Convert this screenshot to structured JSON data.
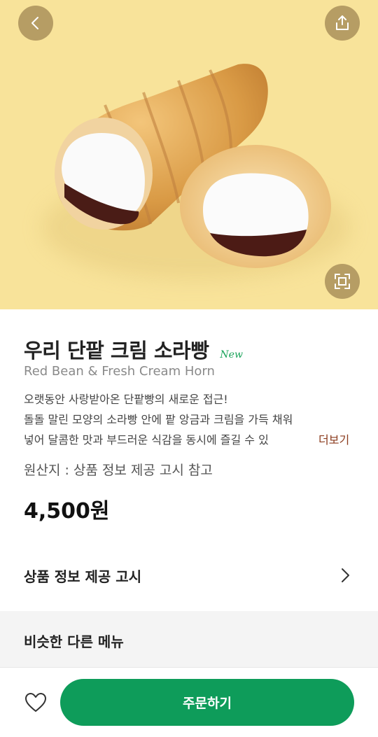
{
  "product": {
    "name": "우리 단팥 크림 소라빵",
    "badge": "New",
    "name_en": "Red Bean & Fresh Cream Horn",
    "description_lines": [
      "오랫동안 사랑받아온 단팥빵의 새로운 접근!",
      "돌돌 말린 모양의 소라빵 안에 팥 앙금과 크림을 가득 채워",
      "넣어 달콤한 맛과 부드러운 식감을 동시에 즐길 수 있"
    ],
    "more_label": "더보기",
    "origin": "원산지 : 상품 정보 제공 고시 참고",
    "price": "4,500원"
  },
  "notice": {
    "label": "상품 정보 제공 고시"
  },
  "similar": {
    "title": "비슷한 다른 메뉴"
  },
  "bottom": {
    "order_label": "주문하기"
  },
  "icons": {
    "back": "chevron-left-icon",
    "share": "share-icon",
    "zoom": "expand-icon",
    "notice_arrow": "chevron-right-icon",
    "favorite": "heart-icon"
  },
  "colors": {
    "hero_bg": "#f8e39a",
    "accent_green": "#0e9c5a",
    "new_badge": "#1aa35a",
    "more_link": "#8a3a1c"
  }
}
